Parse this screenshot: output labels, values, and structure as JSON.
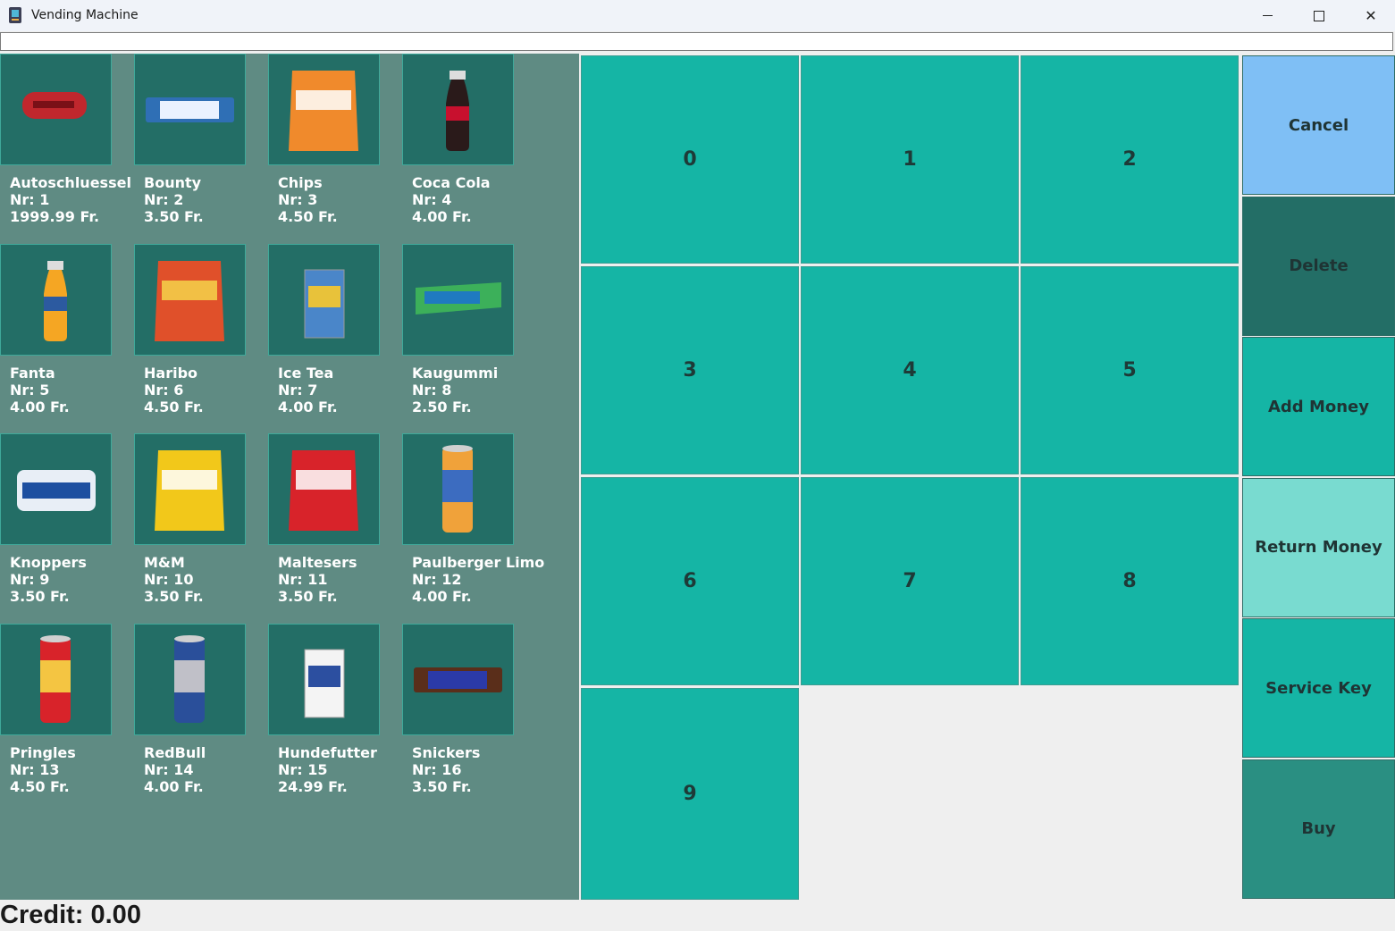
{
  "window": {
    "title": "Vending Machine",
    "controls": {
      "minimize": "—",
      "maximize": "☐",
      "close": "✕"
    }
  },
  "display": {
    "value": ""
  },
  "products": [
    {
      "name": "Autoschluessel",
      "nr": "Nr: 1",
      "price": "1999.99 Fr.",
      "icon": "car-key-icon",
      "color": "#c0272d"
    },
    {
      "name": "Bounty",
      "nr": "Nr: 2",
      "price": "3.50 Fr.",
      "icon": "bounty-bar-icon",
      "color": "#2f6fb5"
    },
    {
      "name": "Chips",
      "nr": "Nr: 3",
      "price": "4.50 Fr.",
      "icon": "chips-bag-icon",
      "color": "#f08a2c"
    },
    {
      "name": "Coca Cola",
      "nr": "Nr: 4",
      "price": "4.00 Fr.",
      "icon": "cola-bottle-icon",
      "color": "#2a1a1a"
    },
    {
      "name": "Fanta",
      "nr": "Nr: 5",
      "price": "4.00 Fr.",
      "icon": "fanta-bottle-icon",
      "color": "#f5a623"
    },
    {
      "name": "Haribo",
      "nr": "Nr: 6",
      "price": "4.50 Fr.",
      "icon": "haribo-bag-icon",
      "color": "#e0502a"
    },
    {
      "name": "Ice Tea",
      "nr": "Nr: 7",
      "price": "4.00 Fr.",
      "icon": "ice-tea-carton-icon",
      "color": "#4a86c9"
    },
    {
      "name": "Kaugummi",
      "nr": "Nr: 8",
      "price": "2.50 Fr.",
      "icon": "chewing-gum-icon",
      "color": "#3cb05a"
    },
    {
      "name": "Knoppers",
      "nr": "Nr: 9",
      "price": "3.50 Fr.",
      "icon": "knoppers-icon",
      "color": "#e8eef6"
    },
    {
      "name": "M&M",
      "nr": "Nr: 10",
      "price": "3.50 Fr.",
      "icon": "mm-bag-icon",
      "color": "#f2c81a"
    },
    {
      "name": "Maltesers",
      "nr": "Nr: 11",
      "price": "3.50 Fr.",
      "icon": "maltesers-bag-icon",
      "color": "#d8232a"
    },
    {
      "name": "Paulberger Limo",
      "nr": "Nr: 12",
      "price": "4.00 Fr.",
      "icon": "limo-can-icon",
      "color": "#f0a23a"
    },
    {
      "name": "Pringles",
      "nr": "Nr: 13",
      "price": "4.50 Fr.",
      "icon": "pringles-can-icon",
      "color": "#d8232a"
    },
    {
      "name": "RedBull",
      "nr": "Nr: 14",
      "price": "4.00 Fr.",
      "icon": "redbull-can-icon",
      "color": "#2a4f9a"
    },
    {
      "name": "Hundefutter",
      "nr": "Nr: 15",
      "price": "24.99 Fr.",
      "icon": "dog-food-icon",
      "color": "#f4f4f4"
    },
    {
      "name": "Snickers",
      "nr": "Nr: 16",
      "price": "3.50 Fr.",
      "icon": "snickers-bar-icon",
      "color": "#5a2e1a"
    }
  ],
  "numpad": [
    "0",
    "1",
    "2",
    "3",
    "4",
    "5",
    "6",
    "7",
    "8",
    "9"
  ],
  "actions": [
    {
      "label": "Cancel",
      "color": "#7fbff5"
    },
    {
      "label": "Delete",
      "color": "#236e66"
    },
    {
      "label": "Add Money",
      "color": "#15b5a5"
    },
    {
      "label": "Return Money",
      "color": "#79dbd0"
    },
    {
      "label": "Service Key",
      "color": "#15b5a5"
    },
    {
      "label": "Buy",
      "color": "#2a8f82"
    }
  ],
  "credit": "Credit: 0.00"
}
